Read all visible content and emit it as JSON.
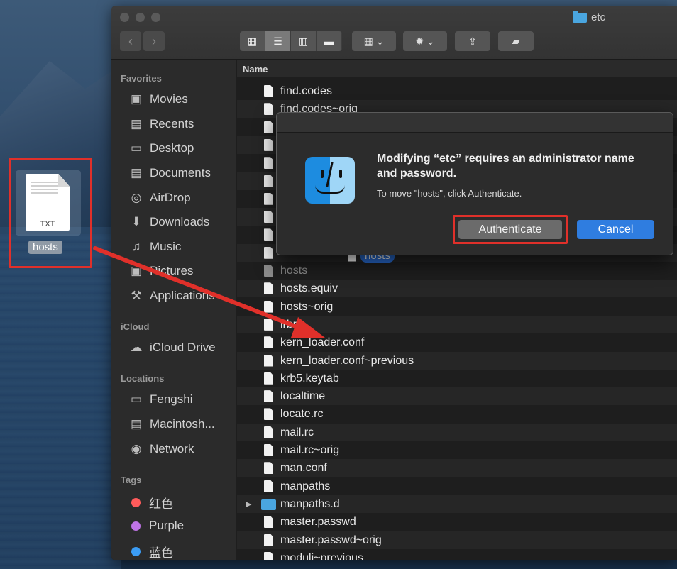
{
  "desktop": {
    "file_type_label": "TXT",
    "file_name": "hosts"
  },
  "window": {
    "title": "etc"
  },
  "sidebar": {
    "favorites_header": "Favorites",
    "favorites": [
      {
        "label": "Movies",
        "icon": "film-icon"
      },
      {
        "label": "Recents",
        "icon": "recents-icon"
      },
      {
        "label": "Desktop",
        "icon": "desktop-icon"
      },
      {
        "label": "Documents",
        "icon": "documents-icon"
      },
      {
        "label": "AirDrop",
        "icon": "airdrop-icon"
      },
      {
        "label": "Downloads",
        "icon": "downloads-icon"
      },
      {
        "label": "Music",
        "icon": "music-icon"
      },
      {
        "label": "Pictures",
        "icon": "pictures-icon"
      },
      {
        "label": "Applications",
        "icon": "applications-icon"
      }
    ],
    "icloud_header": "iCloud",
    "icloud": [
      {
        "label": "iCloud Drive",
        "icon": "cloud-icon"
      }
    ],
    "locations_header": "Locations",
    "locations": [
      {
        "label": "Fengshi",
        "icon": "computer-icon"
      },
      {
        "label": "Macintosh...",
        "icon": "disk-icon"
      },
      {
        "label": "Network",
        "icon": "network-icon"
      }
    ],
    "tags_header": "Tags",
    "tags": [
      {
        "label": "红色",
        "color": "#ff5b5b"
      },
      {
        "label": "Purple",
        "color": "#c074e6"
      },
      {
        "label": "蓝色",
        "color": "#3b9cf4"
      }
    ]
  },
  "list": {
    "column_name": "Name",
    "rows": [
      {
        "name": "find.codes"
      },
      {
        "name": "find.codes~orig"
      },
      {
        "name": ""
      },
      {
        "name": ""
      },
      {
        "name": ""
      },
      {
        "name": ""
      },
      {
        "name": ""
      },
      {
        "name": ""
      },
      {
        "name": ""
      },
      {
        "name": ""
      },
      {
        "name": "hosts"
      },
      {
        "name": "hosts.equiv"
      },
      {
        "name": "hosts~orig"
      },
      {
        "name": "irbrc"
      },
      {
        "name": "kern_loader.conf"
      },
      {
        "name": "kern_loader.conf~previous"
      },
      {
        "name": "krb5.keytab"
      },
      {
        "name": "localtime"
      },
      {
        "name": "locate.rc"
      },
      {
        "name": "mail.rc"
      },
      {
        "name": "mail.rc~orig"
      },
      {
        "name": "man.conf"
      },
      {
        "name": "manpaths"
      },
      {
        "name": "manpaths.d"
      },
      {
        "name": "master.passwd"
      },
      {
        "name": "master.passwd~orig"
      },
      {
        "name": "moduli~previous"
      }
    ]
  },
  "drag": {
    "label": "hosts"
  },
  "dialog": {
    "title": "Modifying “etc” requires an administrator name and password.",
    "message": "To move \"hosts\", click Authenticate.",
    "authenticate_label": "Authenticate",
    "cancel_label": "Cancel"
  },
  "colors": {
    "highlight_red": "#e0302a",
    "accent_blue": "#2f7de0"
  }
}
